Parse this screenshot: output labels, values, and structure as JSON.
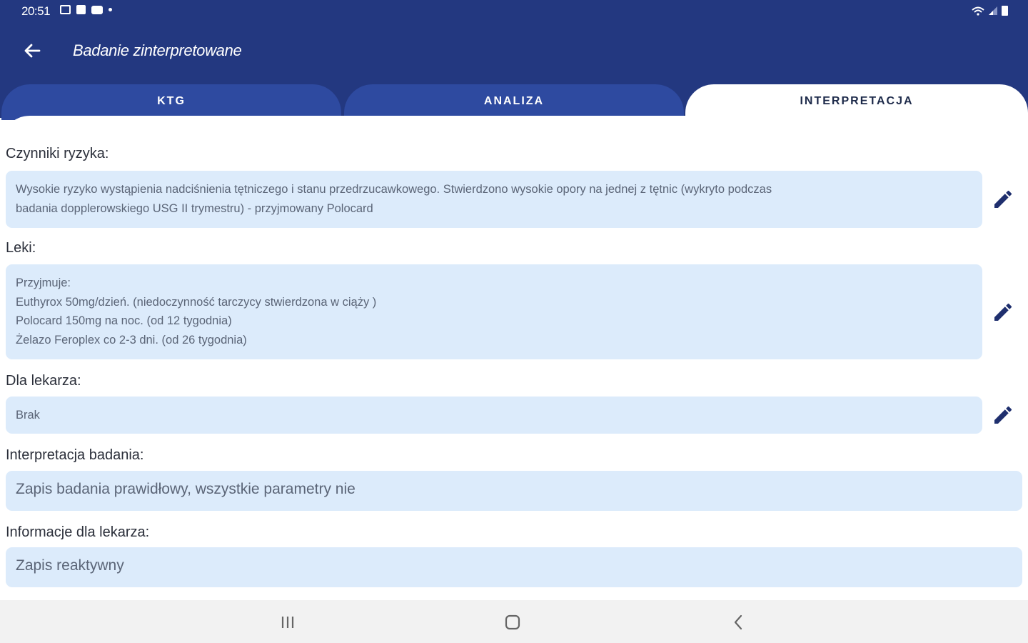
{
  "status_bar": {
    "time": "20:51",
    "left_icons": [
      "image-icon",
      "message-icon",
      "youtube-icon",
      "dot-icon"
    ],
    "right_icons": [
      "wifi-icon",
      "signal-icon",
      "battery-icon"
    ]
  },
  "app_bar": {
    "title": "Badanie zinterpretowane",
    "back_icon": "arrow-left-icon",
    "background_color": "#233880"
  },
  "tabs": [
    {
      "label": "KTG",
      "active": false
    },
    {
      "label": "ANALIZA",
      "active": false
    },
    {
      "label": "INTERPRETACJA",
      "active": true
    }
  ],
  "sections": {
    "risk_factors": {
      "label": "Czynniki ryzyka:",
      "lines": [
        "Wysokie ryzyko wystąpienia nadciśnienia tętniczego i stanu przedrzucawkowego. Stwierdzono wysokie opory na jednej z tętnic (wykryto podczas",
        "badania dopplerowskiego USG II trymestru) - przyjmowany Polocard"
      ],
      "edit_icon": "pencil-icon"
    },
    "medications": {
      "label": "Leki:",
      "lines": [
        "Przyjmuje:",
        "Euthyrox 50mg/dzień. (niedoczynność tarczycy stwierdzona w ciąży )",
        "Polocard 150mg na noc. (od 12 tygodnia)",
        "Żelazo Feroplex co 2-3 dni. (od 26 tygodnia)"
      ],
      "edit_icon": "pencil-icon"
    },
    "for_doctor": {
      "label": "Dla lekarza:",
      "value": "Brak",
      "edit_icon": "pencil-icon"
    },
    "exam_interpretation": {
      "label": "Interpretacja badania:",
      "value": "Zapis badania prawidłowy, wszystkie parametry nie"
    },
    "doctor_info": {
      "label": "Informacje dla lekarza:",
      "value": "Zapis reaktywny"
    }
  },
  "nav_bar": {
    "buttons": [
      "recent-apps-icon",
      "home-icon",
      "back-icon"
    ]
  },
  "colors": {
    "primary": "#233880",
    "tab_inactive": "#2e4aa0",
    "field_background": "#dcebfb",
    "edit_icon": "#1f2f6e"
  }
}
